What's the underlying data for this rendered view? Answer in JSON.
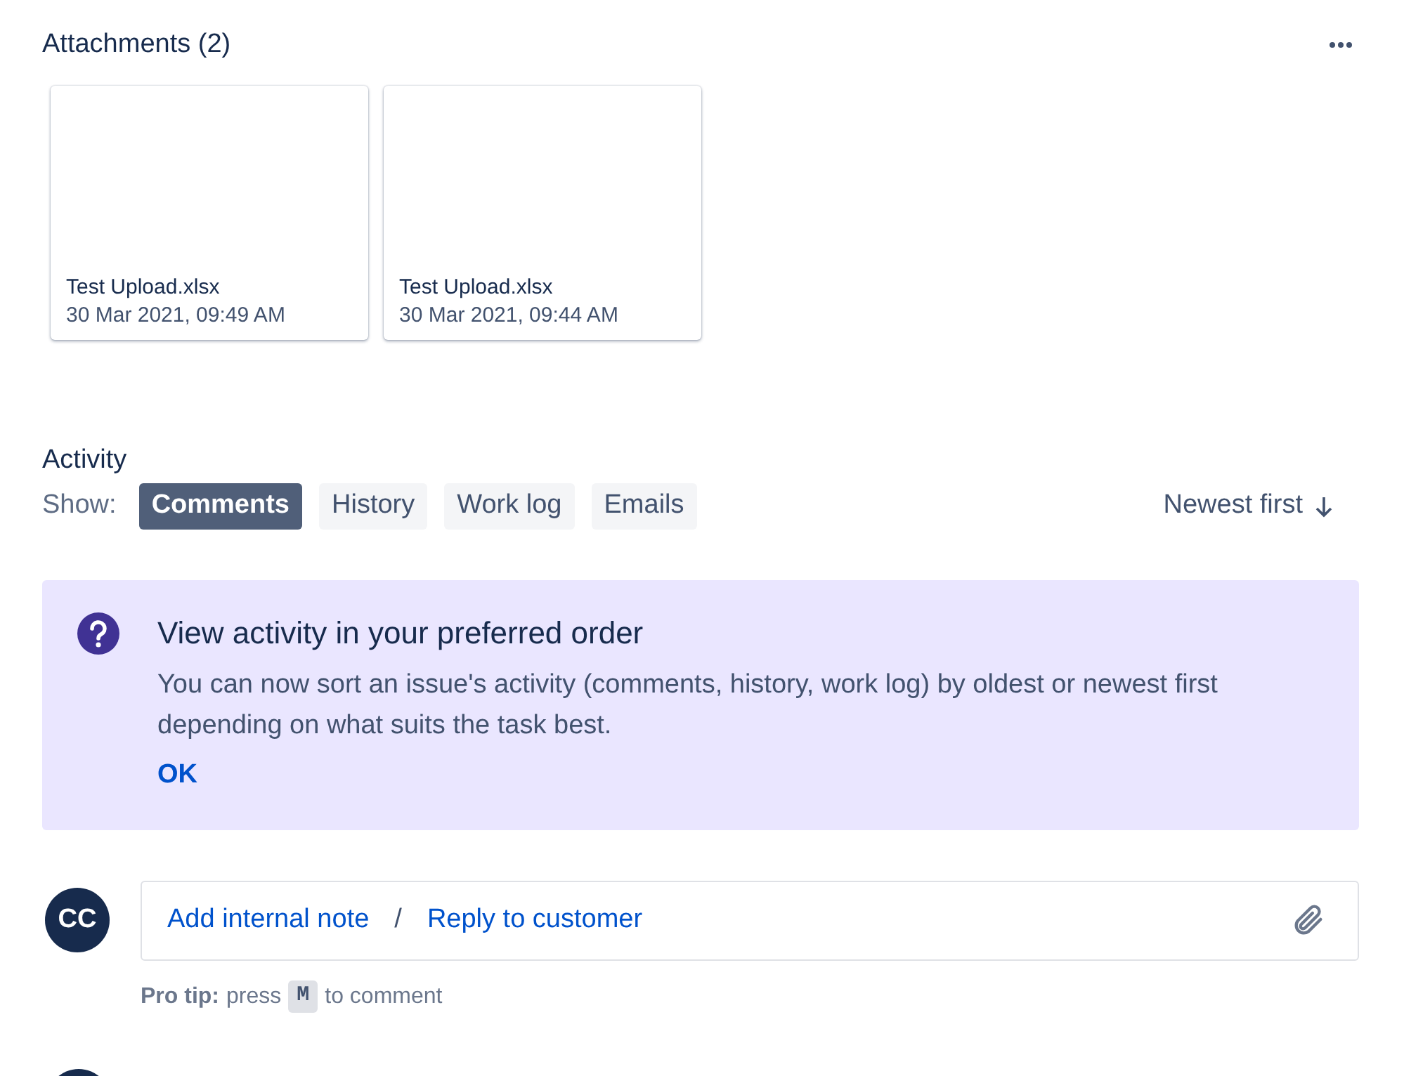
{
  "attachments": {
    "title": "Attachments (2)",
    "items": [
      {
        "name": "Test Upload.xlsx",
        "date": "30 Mar 2021, 09:49 AM"
      },
      {
        "name": "Test Upload.xlsx",
        "date": "30 Mar 2021, 09:44 AM"
      }
    ]
  },
  "activity": {
    "title": "Activity",
    "show_label": "Show:",
    "filters": [
      {
        "label": "Comments",
        "selected": true
      },
      {
        "label": "History",
        "selected": false
      },
      {
        "label": "Work log",
        "selected": false
      },
      {
        "label": "Emails",
        "selected": false
      }
    ],
    "sort": "Newest first"
  },
  "banner": {
    "title": "View activity in your preferred order",
    "body": "You can now sort an issue's activity (comments, history, work log) by oldest or newest first depending on what suits the task best.",
    "action": "OK"
  },
  "comment": {
    "avatar": "CC",
    "actions": [
      "Add internal note",
      "Reply to customer"
    ],
    "separator": "/"
  },
  "pro_tip": {
    "label": "Pro tip:",
    "before": "press",
    "key": "M",
    "after": "to comment"
  }
}
